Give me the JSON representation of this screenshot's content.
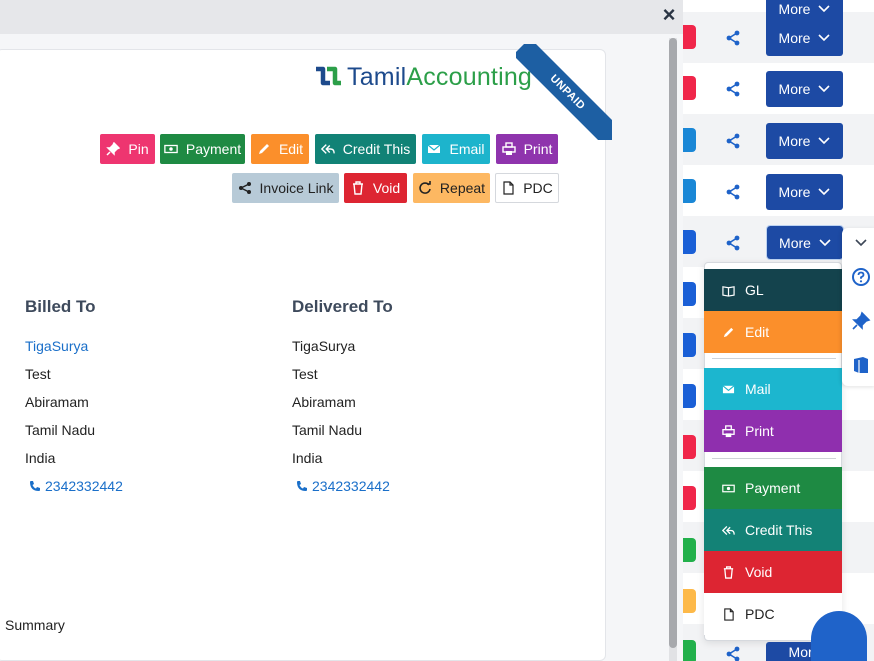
{
  "modal": {
    "close_glyph": "×",
    "brand": {
      "part1": "Tamil",
      "part2": "Accounting",
      "colors": {
        "blue": "#1d4a8c",
        "green": "#2c9f49"
      }
    },
    "status_ribbon": "UNPAID",
    "actions": {
      "pin": "Pin",
      "payment": "Payment",
      "edit": "Edit",
      "credit": "Credit This",
      "email": "Email",
      "print": "Print",
      "invoice_link": "Invoice Link",
      "void": "Void",
      "repeat": "Repeat",
      "pdc": "PDC"
    },
    "billed_to": {
      "heading": "Billed To",
      "name": "TigaSurya",
      "line1": "Test",
      "line2": "Abiramam",
      "state": "Tamil Nadu",
      "country": "India",
      "phone": "2342332442"
    },
    "delivered_to": {
      "heading": "Delivered To",
      "name": "TigaSurya",
      "line1": "Test",
      "line2": "Abiramam",
      "state": "Tamil Nadu",
      "country": "India",
      "phone": "2342332442"
    },
    "summary_label": "Summary"
  },
  "list": {
    "more_label": "More",
    "stripe_colors": [
      "#f0264a",
      "#f0264a",
      "#1a87d6",
      "#1a87d6",
      "#1a5fd6",
      "#1a5fd6",
      "#1a5fd6",
      "#1a5fd6",
      "#f0264a",
      "#f0264a",
      "#22b04b",
      "#fdb949",
      "#22b04b"
    ]
  },
  "dropdown": {
    "gl": "GL",
    "edit": "Edit",
    "mail": "Mail",
    "print": "Print",
    "payment": "Payment",
    "credit": "Credit This",
    "void": "Void",
    "pdc": "PDC"
  }
}
